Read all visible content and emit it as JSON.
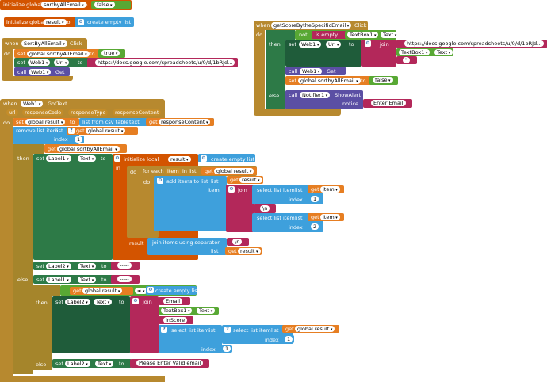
{
  "init1": {
    "label": "initialize global",
    "var": "sortbyAllEmail",
    "to": "to",
    "value": "false"
  },
  "init2": {
    "label": "initialize global",
    "var": "result",
    "to": "to",
    "value": "create empty list"
  },
  "email_click": {
    "when": "when",
    "comp": "SortByAllEmail",
    "evt": "Click",
    "do": "do",
    "set1": "set",
    "set1_var": "global sortbyAllEmail",
    "to": "to",
    "true_val": "true",
    "set2": "set",
    "comp2": "Web1",
    "prop": "Url",
    "url": "https://docs.google.com/spreadsheets/u/0/d/1bRJd...",
    "call": "call",
    "call_comp": "Web1",
    "method": "Get"
  },
  "score_click": {
    "when": "when",
    "comp": "getScoreBytheSpecificEmail",
    "evt": "Click",
    "do": "do",
    "if": "if",
    "not": "not",
    "is_empty": "is empty",
    "tb1": "TextBox1",
    "text": "Text",
    "then": "then",
    "set": "set",
    "web1": "Web1",
    "url": "Url",
    "to": "to",
    "join": "join",
    "url_val": "https://docs.google.com/spreadsheets/u/0/d/1bRJd...",
    "tb_text": "Text",
    "quote": "\"",
    "call": "call",
    "get": "Get",
    "set2_var": "global sortbyAllEmail",
    "false_val": "false",
    "else": "else",
    "notifier": "Notifier1",
    "show_alert": "ShowAlert",
    "notice": "notice",
    "enter_email": "Enter Email"
  },
  "gottext": {
    "when": "when",
    "comp": "Web1",
    "evt": "GotText",
    "p1": "url",
    "p2": "responseCode",
    "p3": "responseType",
    "p4": "responseContent",
    "do": "do",
    "set": "set",
    "global_result": "global result",
    "to": "to",
    "list_csv": "list from csv table",
    "text": "text",
    "get": "get",
    "response_content": "responseContent",
    "remove_list": "remove list item",
    "list": "list",
    "index": "index",
    "one": "1",
    "if": "if",
    "global_sort": "global sortbyAllEmail",
    "then": "then",
    "label1": "Label1",
    "text_prop": "Text",
    "in": "in",
    "init_local": "initialize local",
    "result": "result",
    "create_empty": "create empty list",
    "foreach": "for each",
    "item": "item",
    "in_list": "in list",
    "global_res": "global result",
    "add_items": "add items to list",
    "item_lbl": "item",
    "join": "join",
    "select_list": "select list item",
    "list_lbl": "list",
    "item_var": "item",
    "idx_one": "1",
    "newline": "\\n",
    "idx_two": "2",
    "result_lbl": "result",
    "join_sep": "join items using separator",
    "sep_val": "\\n",
    "list_lbl2": "list",
    "res_var": "result",
    "label2": "Label2",
    "dash": "-----",
    "else": "else",
    "neq": "≠",
    "email_lbl": "Email",
    "tb1": "TextBox1",
    "inScore": "inScore",
    "please": "Please Enter Valid email"
  }
}
